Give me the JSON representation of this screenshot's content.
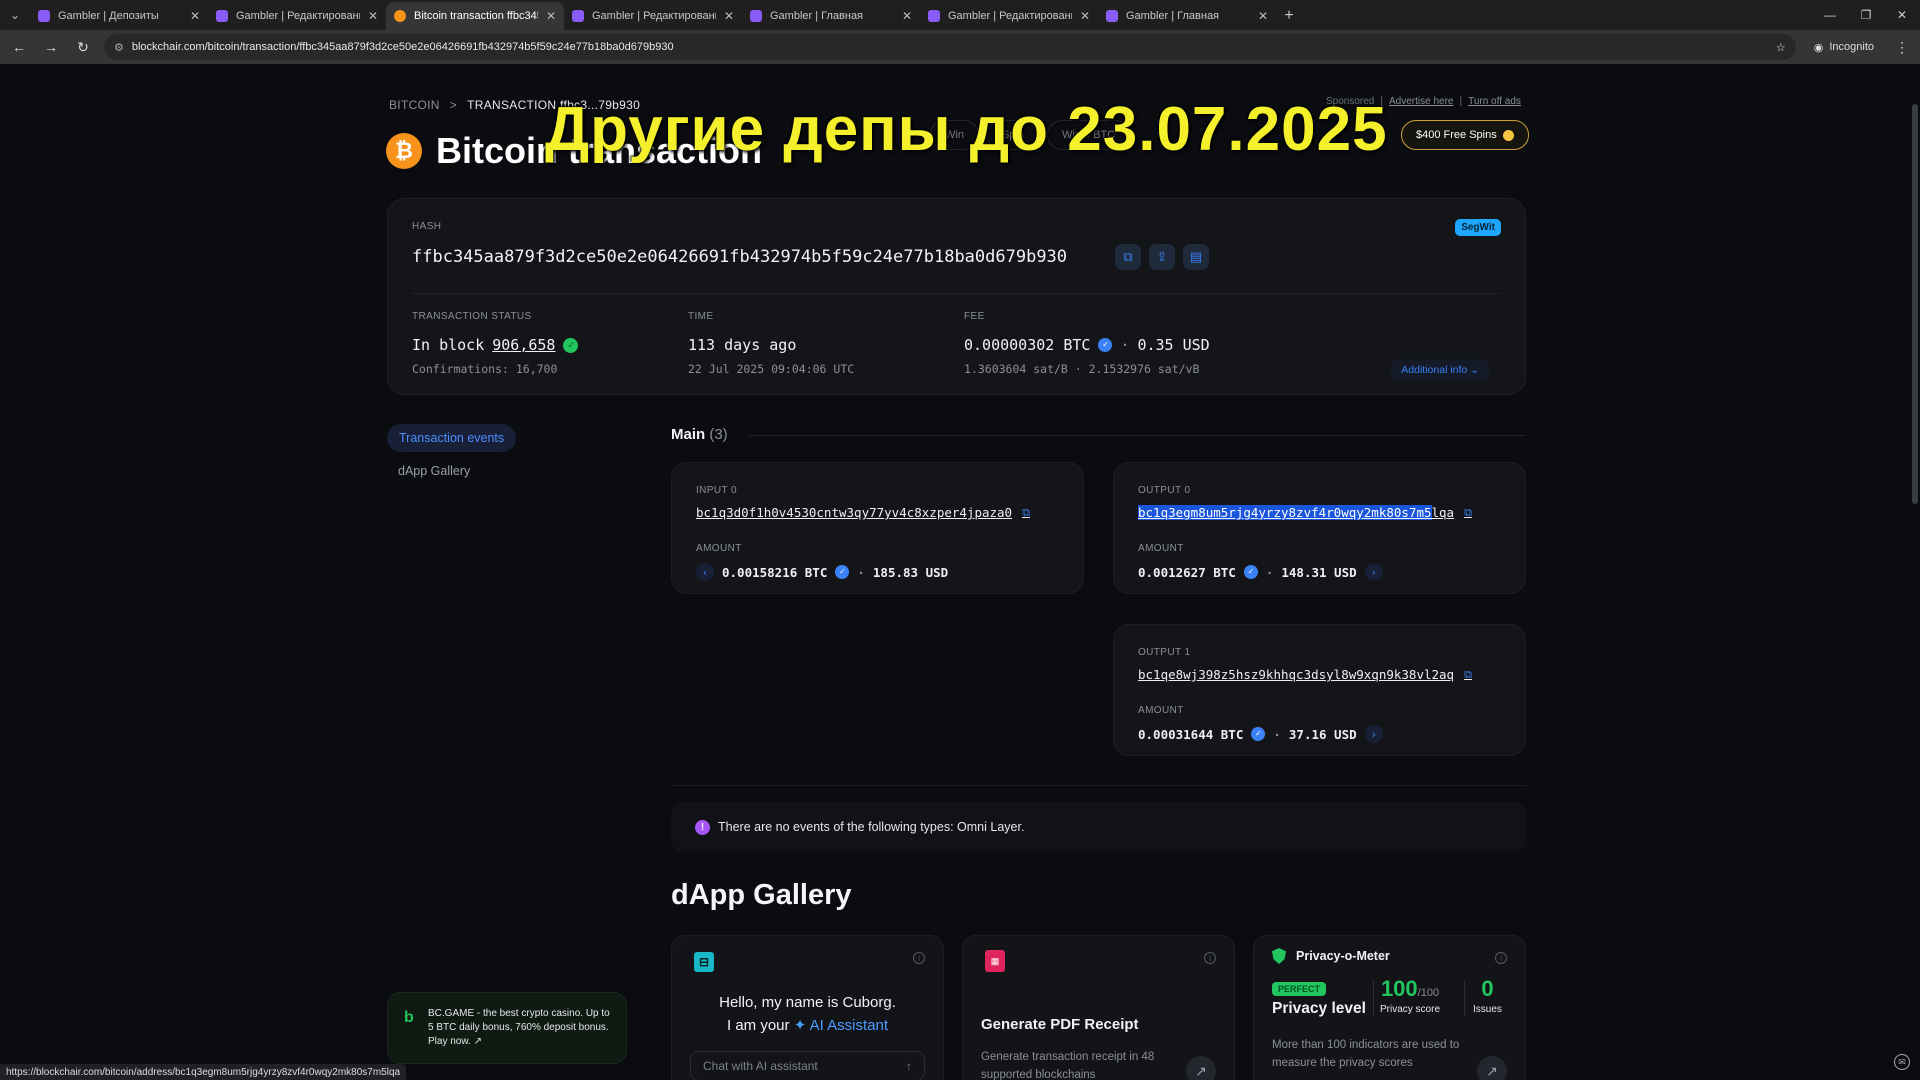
{
  "browser": {
    "tabs": [
      {
        "title": "Gambler | Депозиты",
        "active": false
      },
      {
        "title": "Gambler | Редактирование по...",
        "active": false
      },
      {
        "title": "Bitcoin transaction ffbc345aa8...",
        "active": true
      },
      {
        "title": "Gambler | Редактирование по...",
        "active": false
      },
      {
        "title": "Gambler | Главная",
        "active": false
      },
      {
        "title": "Gambler | Редактирование по...",
        "active": false
      },
      {
        "title": "Gambler | Главная",
        "active": false
      }
    ],
    "url": "blockchair.com/bitcoin/transaction/ffbc345aa879f3d2ce50e2e06426691fb432974b5f59c24e77b18ba0d679b930",
    "incognito_label": "Incognito",
    "status_url": "https://blockchair.com/bitcoin/address/bc1q3egm8um5rjg4yrzy8zvf4r0wqy2mk80s7m5lqa"
  },
  "overlay_text": "Другие депы до 23.07.2025",
  "breadcrumb": {
    "root": "BITCOIN",
    "sep": ">",
    "current": "TRANSACTION ffbc3...79b930"
  },
  "ads": {
    "sponsored": "Sponsored",
    "advertise": "Advertise here",
    "turn_off": "Turn off ads",
    "free_spins": "$400 Free Spins",
    "pills": [
      "Win",
      "Spin",
      "Win 8 BTC"
    ]
  },
  "header": {
    "title": "Bitcoin transaction"
  },
  "hash_card": {
    "hash_label": "HASH",
    "badge": "SegWit",
    "hash": "ffbc345aa879f3d2ce50e2e06426691fb432974b5f59c24e77b18ba0d679b930",
    "status_label": "TRANSACTION STATUS",
    "status_prefix": "In block",
    "block": "906,658",
    "confirmations": "Confirmations: 16,700",
    "time_label": "TIME",
    "time_ago": "113 days ago",
    "time_exact": "22 Jul 2025 09:04:06 UTC",
    "fee_label": "FEE",
    "fee_btc": "0.00000302 BTC",
    "fee_usd": "0.35 USD",
    "fee_rate": "1.3603604 sat/B · 2.1532976 sat/vB",
    "additional_info": "Additional info"
  },
  "sidebar": {
    "active": "Transaction events",
    "item": "dApp Gallery"
  },
  "main": {
    "title": "Main",
    "count": "(3)",
    "input0": {
      "label": "INPUT 0",
      "address": "bc1q3d0f1h0v4530cntw3qy77yv4c8xzper4jpaza0",
      "amount_label": "AMOUNT",
      "btc": "0.00158216 BTC",
      "usd": "185.83 USD"
    },
    "output0": {
      "label": "OUTPUT 0",
      "address_selected": "bc1q3egm8um5rjg4yrzy8zvf4r0wqy2mk80s7m5",
      "address_rest": "lqa",
      "amount_label": "AMOUNT",
      "btc": "0.0012627 BTC",
      "usd": "148.31 USD"
    },
    "output1": {
      "label": "OUTPUT 1",
      "address": "bc1qe8wj398z5hsz9khhqc3dsyl8w9xqn9k38vl2aq",
      "amount_label": "AMOUNT",
      "btc": "0.00031644 BTC",
      "usd": "37.16 USD"
    },
    "notice": "There are no events of the following types: Omni Layer."
  },
  "dapp": {
    "title": "dApp Gallery",
    "cuborg_line1": "Hello, my name is Cuborg.",
    "cuborg_line2_prefix": "I am your",
    "cuborg_line2_ai": "AI Assistant",
    "chat_placeholder": "Chat with AI assistant",
    "pdf_title": "Generate PDF Receipt",
    "pdf_desc": "Generate transaction receipt in 48 supported blockchains",
    "pm_title": "Privacy-o-Meter",
    "pm_badge": "PERFECT",
    "pm_level": "Privacy level",
    "pm_score": "100",
    "pm_score_max": "/100",
    "pm_score_label": "Privacy score",
    "pm_issues": "0",
    "pm_issues_label": "Issues",
    "pm_desc": "More than 100 indicators are used to measure the privacy scores"
  },
  "bc_ad": {
    "text": "BC.GAME - the best crypto casino. Up to 5 BTC daily bonus, 760% deposit bonus. Play now. ↗"
  }
}
